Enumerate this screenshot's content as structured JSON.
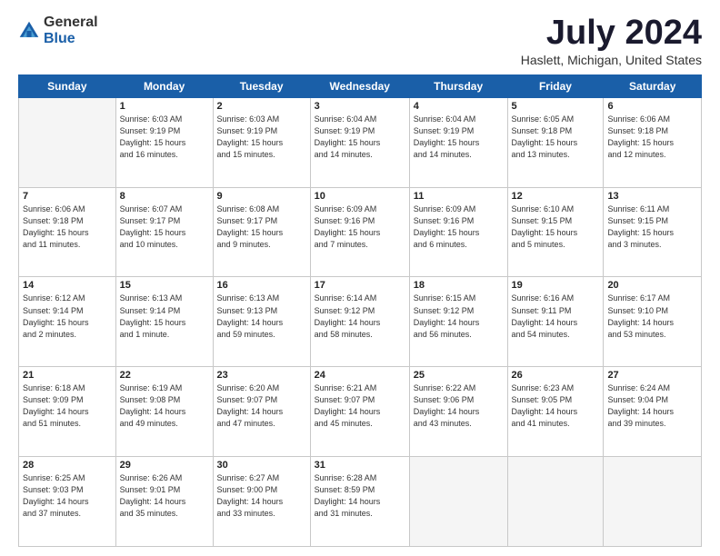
{
  "logo": {
    "general": "General",
    "blue": "Blue"
  },
  "title": "July 2024",
  "location": "Haslett, Michigan, United States",
  "days_of_week": [
    "Sunday",
    "Monday",
    "Tuesday",
    "Wednesday",
    "Thursday",
    "Friday",
    "Saturday"
  ],
  "weeks": [
    [
      {
        "num": "",
        "info": ""
      },
      {
        "num": "1",
        "info": "Sunrise: 6:03 AM\nSunset: 9:19 PM\nDaylight: 15 hours\nand 16 minutes."
      },
      {
        "num": "2",
        "info": "Sunrise: 6:03 AM\nSunset: 9:19 PM\nDaylight: 15 hours\nand 15 minutes."
      },
      {
        "num": "3",
        "info": "Sunrise: 6:04 AM\nSunset: 9:19 PM\nDaylight: 15 hours\nand 14 minutes."
      },
      {
        "num": "4",
        "info": "Sunrise: 6:04 AM\nSunset: 9:19 PM\nDaylight: 15 hours\nand 14 minutes."
      },
      {
        "num": "5",
        "info": "Sunrise: 6:05 AM\nSunset: 9:18 PM\nDaylight: 15 hours\nand 13 minutes."
      },
      {
        "num": "6",
        "info": "Sunrise: 6:06 AM\nSunset: 9:18 PM\nDaylight: 15 hours\nand 12 minutes."
      }
    ],
    [
      {
        "num": "7",
        "info": "Sunrise: 6:06 AM\nSunset: 9:18 PM\nDaylight: 15 hours\nand 11 minutes."
      },
      {
        "num": "8",
        "info": "Sunrise: 6:07 AM\nSunset: 9:17 PM\nDaylight: 15 hours\nand 10 minutes."
      },
      {
        "num": "9",
        "info": "Sunrise: 6:08 AM\nSunset: 9:17 PM\nDaylight: 15 hours\nand 9 minutes."
      },
      {
        "num": "10",
        "info": "Sunrise: 6:09 AM\nSunset: 9:16 PM\nDaylight: 15 hours\nand 7 minutes."
      },
      {
        "num": "11",
        "info": "Sunrise: 6:09 AM\nSunset: 9:16 PM\nDaylight: 15 hours\nand 6 minutes."
      },
      {
        "num": "12",
        "info": "Sunrise: 6:10 AM\nSunset: 9:15 PM\nDaylight: 15 hours\nand 5 minutes."
      },
      {
        "num": "13",
        "info": "Sunrise: 6:11 AM\nSunset: 9:15 PM\nDaylight: 15 hours\nand 3 minutes."
      }
    ],
    [
      {
        "num": "14",
        "info": "Sunrise: 6:12 AM\nSunset: 9:14 PM\nDaylight: 15 hours\nand 2 minutes."
      },
      {
        "num": "15",
        "info": "Sunrise: 6:13 AM\nSunset: 9:14 PM\nDaylight: 15 hours\nand 1 minute."
      },
      {
        "num": "16",
        "info": "Sunrise: 6:13 AM\nSunset: 9:13 PM\nDaylight: 14 hours\nand 59 minutes."
      },
      {
        "num": "17",
        "info": "Sunrise: 6:14 AM\nSunset: 9:12 PM\nDaylight: 14 hours\nand 58 minutes."
      },
      {
        "num": "18",
        "info": "Sunrise: 6:15 AM\nSunset: 9:12 PM\nDaylight: 14 hours\nand 56 minutes."
      },
      {
        "num": "19",
        "info": "Sunrise: 6:16 AM\nSunset: 9:11 PM\nDaylight: 14 hours\nand 54 minutes."
      },
      {
        "num": "20",
        "info": "Sunrise: 6:17 AM\nSunset: 9:10 PM\nDaylight: 14 hours\nand 53 minutes."
      }
    ],
    [
      {
        "num": "21",
        "info": "Sunrise: 6:18 AM\nSunset: 9:09 PM\nDaylight: 14 hours\nand 51 minutes."
      },
      {
        "num": "22",
        "info": "Sunrise: 6:19 AM\nSunset: 9:08 PM\nDaylight: 14 hours\nand 49 minutes."
      },
      {
        "num": "23",
        "info": "Sunrise: 6:20 AM\nSunset: 9:07 PM\nDaylight: 14 hours\nand 47 minutes."
      },
      {
        "num": "24",
        "info": "Sunrise: 6:21 AM\nSunset: 9:07 PM\nDaylight: 14 hours\nand 45 minutes."
      },
      {
        "num": "25",
        "info": "Sunrise: 6:22 AM\nSunset: 9:06 PM\nDaylight: 14 hours\nand 43 minutes."
      },
      {
        "num": "26",
        "info": "Sunrise: 6:23 AM\nSunset: 9:05 PM\nDaylight: 14 hours\nand 41 minutes."
      },
      {
        "num": "27",
        "info": "Sunrise: 6:24 AM\nSunset: 9:04 PM\nDaylight: 14 hours\nand 39 minutes."
      }
    ],
    [
      {
        "num": "28",
        "info": "Sunrise: 6:25 AM\nSunset: 9:03 PM\nDaylight: 14 hours\nand 37 minutes."
      },
      {
        "num": "29",
        "info": "Sunrise: 6:26 AM\nSunset: 9:01 PM\nDaylight: 14 hours\nand 35 minutes."
      },
      {
        "num": "30",
        "info": "Sunrise: 6:27 AM\nSunset: 9:00 PM\nDaylight: 14 hours\nand 33 minutes."
      },
      {
        "num": "31",
        "info": "Sunrise: 6:28 AM\nSunset: 8:59 PM\nDaylight: 14 hours\nand 31 minutes."
      },
      {
        "num": "",
        "info": ""
      },
      {
        "num": "",
        "info": ""
      },
      {
        "num": "",
        "info": ""
      }
    ]
  ]
}
